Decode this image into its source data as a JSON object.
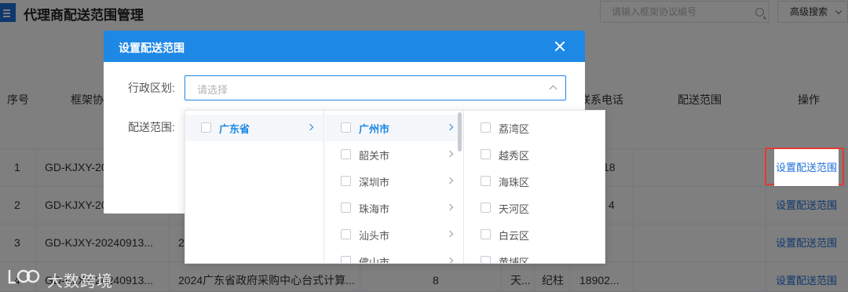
{
  "header": {
    "title": "代理商配送范围管理",
    "search_placeholder": "请输入框架协议编号",
    "advanced_search_label": "高级搜索"
  },
  "table": {
    "columns": [
      "序号",
      "框架协",
      "联系电话",
      "配送范围",
      "操作"
    ],
    "rows": [
      {
        "index": "1",
        "agreement_no": "GD-KJXY-20",
        "mid_a": "",
        "mid_b": "",
        "mid_c": "",
        "contact": "",
        "phone": "18",
        "action": "设置配送范围"
      },
      {
        "index": "2",
        "agreement_no": "GD-KJXY-20",
        "mid_a": "",
        "mid_b": "",
        "mid_c": "",
        "contact": "",
        "phone": "4",
        "action": "设置配送范围"
      },
      {
        "index": "3",
        "agreement_no": "GD-KJXY-20240913...",
        "mid_a": "2",
        "mid_b": "",
        "mid_c": "",
        "contact": "",
        "phone": "",
        "action": "设置配送范围"
      },
      {
        "index": "4",
        "agreement_no": "GD-KJXY-20240913...",
        "mid_a": "2024广东省政府采购中心台式计算...",
        "mid_b": "8",
        "mid_c": "天...",
        "contact": "纪柱",
        "phone": "18902...",
        "action": "设置配送范围"
      }
    ]
  },
  "dialog": {
    "title": "设置配送范围",
    "region_label": "行政区划:",
    "region_placeholder": "请选择",
    "scope_label": "配送范围:"
  },
  "cascader": {
    "provinces": [
      "广东省"
    ],
    "cities": [
      "广州市",
      "韶关市",
      "深圳市",
      "珠海市",
      "汕头市",
      "佛山市"
    ],
    "districts": [
      "荔湾区",
      "越秀区",
      "海珠区",
      "天河区",
      "白云区",
      "黄埔区"
    ],
    "active_province": "广东省",
    "active_city": "广州市"
  },
  "watermark": {
    "text": "大数跨境"
  },
  "colors": {
    "primary": "#1e88e5",
    "highlight": "#e23b2f"
  }
}
